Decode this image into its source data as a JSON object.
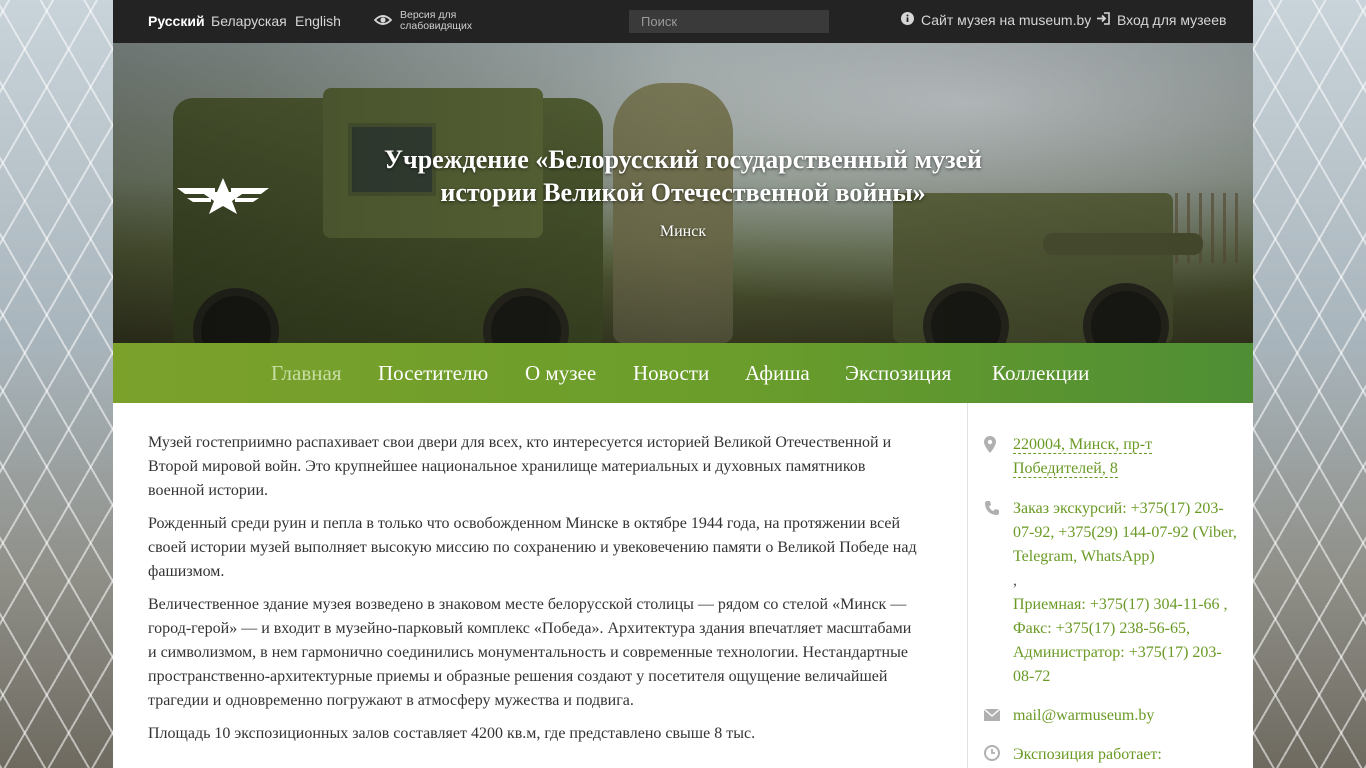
{
  "topbar": {
    "lang_ru": "Русский",
    "lang_be": "Беларуская",
    "lang_en": "English",
    "vision_line1": "Версия для",
    "vision_line2": "слабовидящих",
    "search_placeholder": "Поиск",
    "site_link": "Сайт музея на museum.by",
    "login_link": "Вход для музеев"
  },
  "hero": {
    "title_line1": "Учреждение «Белорусский государственный музей",
    "title_line2": "истории Великой Отечественной войны»",
    "city": "Минск"
  },
  "nav": {
    "items": [
      "Главная",
      "Посетителю",
      "О музее",
      "Новости",
      "Афиша",
      "Экспозиция",
      "Коллекции"
    ],
    "active": "Главная",
    "color_start": "#7ba12b",
    "color_end": "#4f8e35"
  },
  "main": {
    "paragraphs": [
      "Музей гостеприимно распахивает свои двери для всех, кто интересуется историей Великой Отечественной и Второй мировой войн. Это крупнейшее национальное хранилище материальных и духовных памятников военной истории.",
      "Рожденный среди руин и пепла в только что освобожденном Минске в октябре 1944 года, на протяжении всей своей истории музей выполняет высокую миссию по сохранению и увековечению памяти о Великой Победе над фашизмом.",
      "Величественное здание музея возведено в знаковом месте белорусской столицы — рядом со стелой «Минск — город-герой» — и входит в музейно-парковый комплекс «Победа». Архитектура здания впечатляет масштабами и символизмом, в нем гармонично соединились монументальность и современные технологии. Нестандартные пространственно-архитектурные приемы и образные решения создают у посетителя ощущение величайшей трагедии и одновременно погружают в атмосферу мужества и подвига.",
      "Площадь 10 экспозиционных залов составляет 4200 кв.м, где представлено свыше 8 тыс."
    ]
  },
  "aside": {
    "address": "220004, Минск, пр-т Победителей, 8",
    "phones_line1": "Заказ экскурсий: +375(17) 203-07-92, +375(29) 144-07-92 (Viber, Telegram, WhatsApp)",
    "phones_comma": ",",
    "phones_line2": "Приемная: +375(17) 304-11-66 , Факс: +375(17) 238-56-65, Администратор: +375(17) 203-08-72",
    "email": "mail@warmuseum.by",
    "hours_label": "Экспозиция работает:",
    "accent_color": "#6a9a25"
  },
  "icons": {
    "vision": "eye-icon",
    "site": "info-icon",
    "login": "login-icon",
    "address": "map-marker-icon",
    "phone": "phone-icon",
    "email": "envelope-icon",
    "hours": "clock-icon"
  }
}
